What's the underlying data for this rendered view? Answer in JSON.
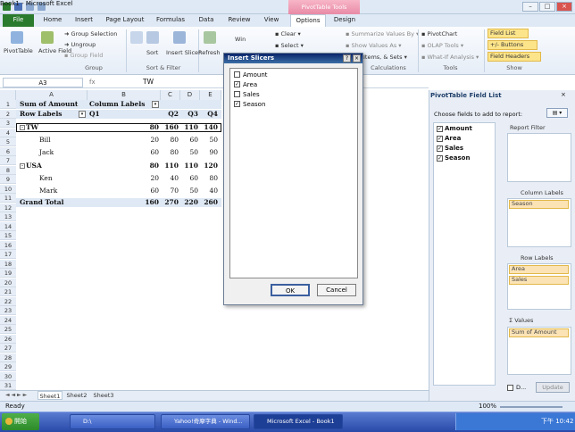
{
  "window": {
    "title": "Book1 - Microsoft Excel",
    "contextual_tab_group": "PivotTable Tools"
  },
  "tabs": [
    "File",
    "Home",
    "Insert",
    "Page Layout",
    "Formulas",
    "Data",
    "Review",
    "View",
    "Options",
    "Design"
  ],
  "ribbon": {
    "pivottable_label": "PivotTable",
    "active_field_label": "Active\nField",
    "active_field_label_short": "Active Field",
    "group_selection": "Group Selection",
    "ungroup": "Ungroup",
    "group_field": "Group Field",
    "group_label": "Group",
    "sort_label": "Sort",
    "insert_slicer_label": "Insert Slicer",
    "sort_filter_label": "Sort & Filter",
    "refresh_label": "Refresh",
    "change_source_label": "Win",
    "clear_label": "Clear",
    "select_label": "Select",
    "summarize_values": "Summarize Values By",
    "show_values_as": "Show Values As",
    "items_sets": "Items, & Sets",
    "calculations_label": "Calculations",
    "pivotchart": "PivotChart",
    "olap_tools": "OLAP Tools",
    "what_if": "What-If Analysis",
    "tools_label": "Tools",
    "field_list": "Field List",
    "buttons": "+/- Buttons",
    "field_headers": "Field Headers",
    "show_label": "Show"
  },
  "formula_bar": {
    "name_box": "A3",
    "value": "TW"
  },
  "columns": [
    "A",
    "B",
    "C",
    "D",
    "E"
  ],
  "rows": [
    "1",
    "2",
    "3",
    "4",
    "5",
    "6",
    "7",
    "8",
    "9",
    "10",
    "11",
    "12",
    "13",
    "14",
    "15",
    "16",
    "17",
    "18",
    "19",
    "20",
    "21",
    "22",
    "23",
    "24",
    "25",
    "26",
    "27",
    "28",
    "29",
    "30",
    "31",
    "32"
  ],
  "pivot": {
    "r1": {
      "a": "Sum of Amount",
      "b": "Column Labels"
    },
    "r2": {
      "a": "Row Labels",
      "b": "Q1",
      "c": "Q2",
      "d": "Q3",
      "e": "Q4"
    },
    "r3": {
      "a": "TW",
      "b": "80",
      "c": "160",
      "d": "110",
      "e": "140"
    },
    "r4": {
      "a": "Bill",
      "b": "20",
      "c": "80",
      "d": "60",
      "e": "50"
    },
    "r5": {
      "a": "Jack",
      "b": "60",
      "c": "80",
      "d": "50",
      "e": "90"
    },
    "r6": {
      "a": "USA",
      "b": "80",
      "c": "110",
      "d": "110",
      "e": "120"
    },
    "r7": {
      "a": "Ken",
      "b": "20",
      "c": "40",
      "d": "60",
      "e": "80"
    },
    "r8": {
      "a": "Mark",
      "b": "60",
      "c": "70",
      "d": "50",
      "e": "40"
    },
    "r9": {
      "a": "Grand Total",
      "b": "160",
      "c": "270",
      "d": "220",
      "e": "260"
    }
  },
  "sheets": [
    "Sheet1",
    "Sheet2",
    "Sheet3"
  ],
  "status": {
    "ready": "Ready",
    "zoom": "100%"
  },
  "dialog": {
    "title": "Insert Slicers",
    "items": [
      {
        "label": "Amount",
        "checked": false
      },
      {
        "label": "Area",
        "checked": true
      },
      {
        "label": "Sales",
        "checked": false
      },
      {
        "label": "Season",
        "checked": true
      }
    ],
    "ok": "OK",
    "cancel": "Cancel"
  },
  "field_list": {
    "title": "PivotTable Field List",
    "prompt": "Choose fields to add to report:",
    "fields": [
      {
        "label": "Amount",
        "checked": true
      },
      {
        "label": "Area",
        "checked": true
      },
      {
        "label": "Sales",
        "checked": true
      },
      {
        "label": "Season",
        "checked": true
      }
    ],
    "report_filter": "Report Filter",
    "column_labels": "Column Labels",
    "column_item": "Season",
    "row_labels": "Row Labels",
    "row_items": [
      "Area",
      "Sales"
    ],
    "values": "Values",
    "value_item": "Sum of Amount",
    "defer_label": "D...",
    "update_label": "Update"
  },
  "taskbar": {
    "start": "開始",
    "tasks": [
      "D:\\",
      "Yahoo!奇摩字典 - Wind...",
      "Microsoft Excel - Book1"
    ],
    "clock": "下午 10:42"
  },
  "colors": {
    "file_tab": "#2b7b2e",
    "pivot_tools": "#e98aa6",
    "highlight": "#fce48a"
  }
}
